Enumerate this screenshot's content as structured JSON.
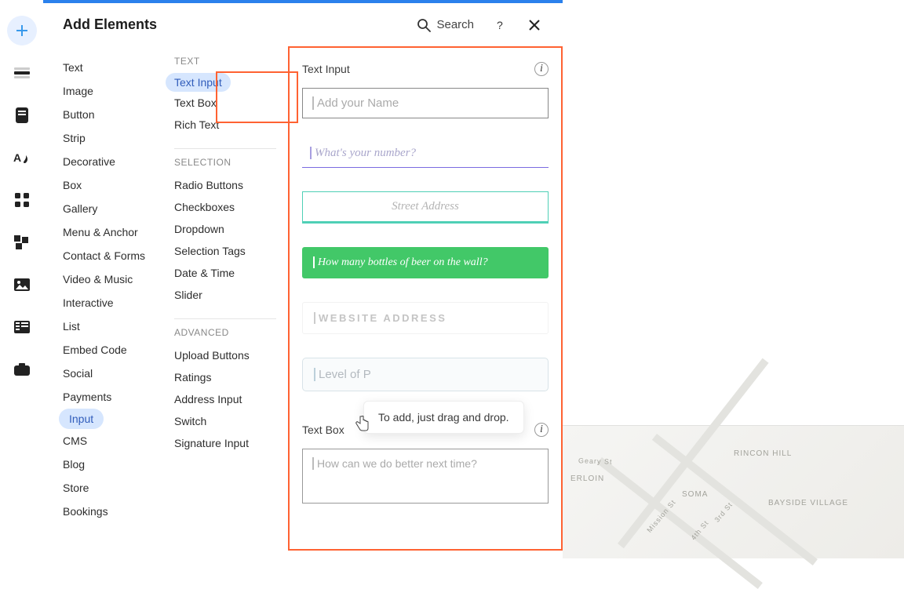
{
  "panel": {
    "title": "Add Elements",
    "search_label": "Search"
  },
  "primary": {
    "items": [
      "Text",
      "Image",
      "Button",
      "Strip",
      "Decorative",
      "Box",
      "Gallery",
      "Menu & Anchor",
      "Contact & Forms",
      "Video & Music",
      "Interactive",
      "List",
      "Embed Code",
      "Social",
      "Payments",
      "Input",
      "CMS",
      "Blog",
      "Store",
      "Bookings"
    ],
    "active_index": 15
  },
  "secondary": {
    "groups": [
      {
        "label": "TEXT",
        "items": [
          "Text Input",
          "Text Box",
          "Rich Text"
        ],
        "active_index": 0
      },
      {
        "label": "SELECTION",
        "items": [
          "Radio Buttons",
          "Checkboxes",
          "Dropdown",
          "Selection Tags",
          "Date & Time",
          "Slider"
        ]
      },
      {
        "label": "ADVANCED",
        "items": [
          "Upload Buttons",
          "Ratings",
          "Address Input",
          "Switch",
          "Signature Input"
        ]
      }
    ]
  },
  "preview": {
    "section1": "Text Input",
    "section2": "Text Box",
    "info_char": "i",
    "samples": {
      "name": "Add your Name",
      "number": "What's your number?",
      "street": "Street Address",
      "bottles": "How many bottles of beer on the wall?",
      "website": "WEBSITE ADDRESS",
      "level": "Level of P",
      "textbox": "How can we do better next time?"
    }
  },
  "tooltip": {
    "text": "To add, just drag and drop."
  },
  "map": {
    "labels": {
      "rincon": "RINCON HILL",
      "soma": "SOMA",
      "bayside": "BAYSIDE VILLAGE",
      "erloin": "ERLOIN",
      "geary": "Geary St",
      "mission": "Mission St",
      "third": "3rd St",
      "fourth": "4th St"
    }
  }
}
